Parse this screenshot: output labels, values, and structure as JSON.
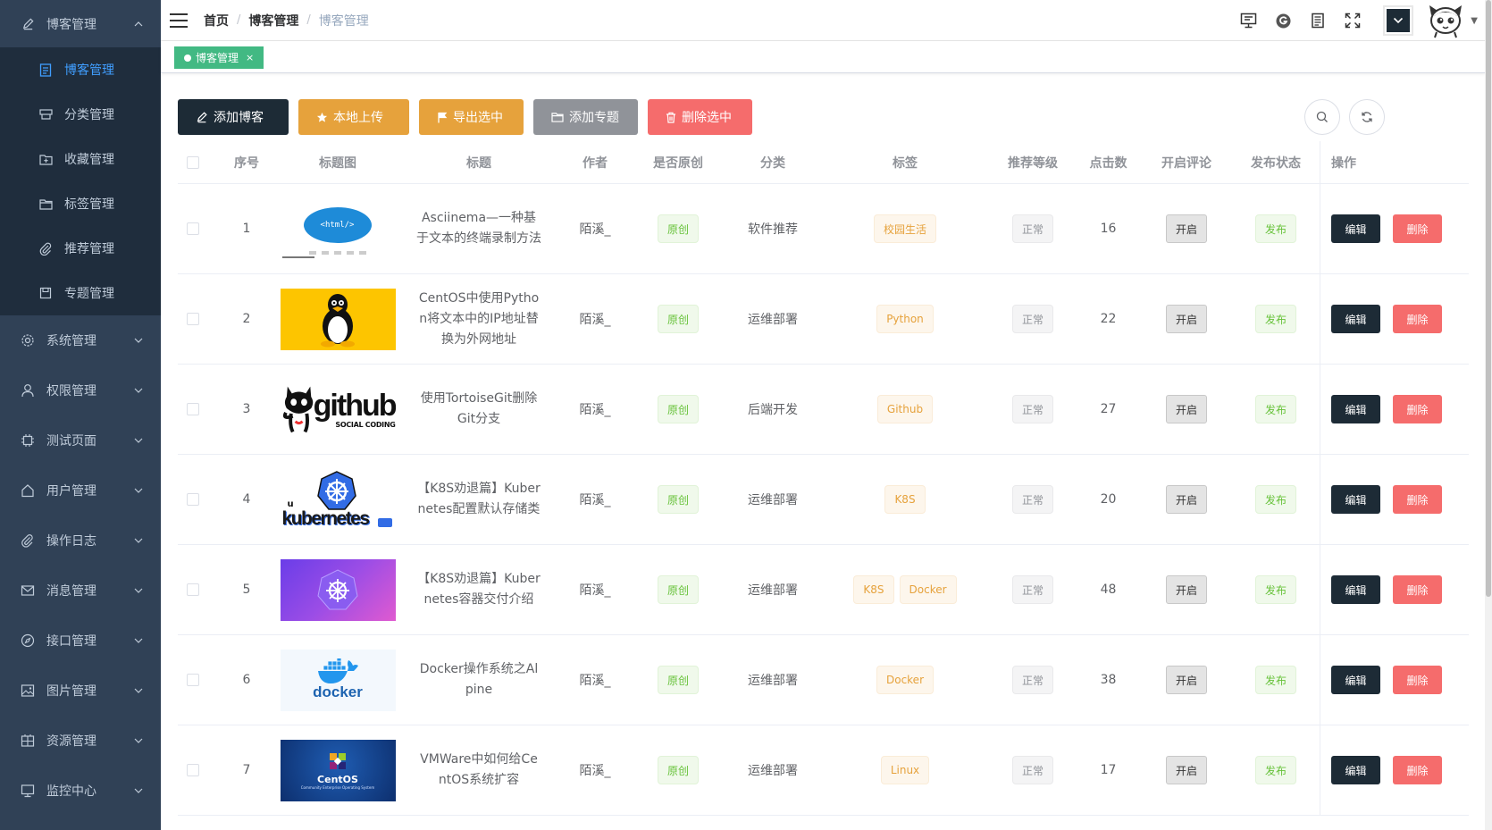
{
  "sidebar": {
    "open_menu": {
      "label": "博客管理",
      "icon": "edit-icon"
    },
    "sub_items": [
      {
        "label": "博客管理",
        "icon": "document-icon",
        "active": true
      },
      {
        "label": "分类管理",
        "icon": "category-icon"
      },
      {
        "label": "收藏管理",
        "icon": "folder-add-icon"
      },
      {
        "label": "标签管理",
        "icon": "folder-icon"
      },
      {
        "label": "推荐管理",
        "icon": "paperclip-icon"
      },
      {
        "label": "专题管理",
        "icon": "save-icon"
      }
    ],
    "groups": [
      {
        "label": "系统管理",
        "icon": "gear-icon"
      },
      {
        "label": "权限管理",
        "icon": "user-icon"
      },
      {
        "label": "测试页面",
        "icon": "chip-icon"
      },
      {
        "label": "用户管理",
        "icon": "house-icon"
      },
      {
        "label": "操作日志",
        "icon": "paperclip-icon"
      },
      {
        "label": "消息管理",
        "icon": "message-icon"
      },
      {
        "label": "接口管理",
        "icon": "compass-icon"
      },
      {
        "label": "图片管理",
        "icon": "picture-icon"
      },
      {
        "label": "资源管理",
        "icon": "grid-icon"
      },
      {
        "label": "监控中心",
        "icon": "monitor-icon"
      }
    ]
  },
  "navbar": {
    "breadcrumb": [
      "首页",
      "博客管理",
      "博客管理"
    ],
    "icons": [
      "monitor-icon",
      "g-circle-icon",
      "document-icon",
      "fullscreen-icon"
    ]
  },
  "tagsview": {
    "active_tag": "博客管理",
    "close": "×"
  },
  "toolbar": {
    "add_blog": "添加博客",
    "local_upload": "本地上传",
    "export_selected": "导出选中",
    "add_subject": "添加专题",
    "delete_selected": "删除选中"
  },
  "table": {
    "headers": {
      "no": "序号",
      "image": "标题图",
      "title": "标题",
      "author": "作者",
      "original": "是否原创",
      "category": "分类",
      "tags": "标签",
      "level": "推荐等级",
      "clicks": "点击数",
      "comment": "开启评论",
      "status": "发布状态",
      "ops": "操作"
    },
    "rows": [
      {
        "no": "1",
        "thumb": "html",
        "title": "Asciinema—一种基于文本的终端录制方法",
        "author": "陌溪_",
        "original": "原创",
        "category": "软件推荐",
        "tags": [
          "校园生活"
        ],
        "level": "正常",
        "clicks": "16",
        "comment": "开启",
        "status": "发布",
        "edit": "编辑",
        "delete": "删除"
      },
      {
        "no": "2",
        "thumb": "linux",
        "title": "CentOS中使用Python将文本中的IP地址替换为外网地址",
        "author": "陌溪_",
        "original": "原创",
        "category": "运维部署",
        "tags": [
          "Python"
        ],
        "level": "正常",
        "clicks": "22",
        "comment": "开启",
        "status": "发布",
        "edit": "编辑",
        "delete": "删除"
      },
      {
        "no": "3",
        "thumb": "github",
        "title": "使用TortoiseGit删除Git分支",
        "author": "陌溪_",
        "original": "原创",
        "category": "后端开发",
        "tags": [
          "Github"
        ],
        "level": "正常",
        "clicks": "27",
        "comment": "开启",
        "status": "发布",
        "edit": "编辑",
        "delete": "删除"
      },
      {
        "no": "4",
        "thumb": "kubernetes",
        "title": "【K8S劝退篇】Kubernetes配置默认存储类",
        "author": "陌溪_",
        "original": "原创",
        "category": "运维部署",
        "tags": [
          "K8S"
        ],
        "level": "正常",
        "clicks": "20",
        "comment": "开启",
        "status": "发布",
        "edit": "编辑",
        "delete": "删除"
      },
      {
        "no": "5",
        "thumb": "k8s-purple",
        "title": "【K8S劝退篇】Kubernetes容器交付介绍",
        "author": "陌溪_",
        "original": "原创",
        "category": "运维部署",
        "tags": [
          "K8S",
          "Docker"
        ],
        "level": "正常",
        "clicks": "48",
        "comment": "开启",
        "status": "发布",
        "edit": "编辑",
        "delete": "删除"
      },
      {
        "no": "6",
        "thumb": "docker",
        "title": "Docker操作系统之Alpine",
        "author": "陌溪_",
        "original": "原创",
        "category": "运维部署",
        "tags": [
          "Docker"
        ],
        "level": "正常",
        "clicks": "38",
        "comment": "开启",
        "status": "发布",
        "edit": "编辑",
        "delete": "删除"
      },
      {
        "no": "7",
        "thumb": "centos",
        "title": "VMWare中如何给CentOS系统扩容",
        "author": "陌溪_",
        "original": "原创",
        "category": "运维部署",
        "tags": [
          "Linux"
        ],
        "level": "正常",
        "clicks": "17",
        "comment": "开启",
        "status": "发布",
        "edit": "编辑",
        "delete": "删除"
      }
    ]
  },
  "thumb_text": {
    "html": "<html/>",
    "github": "github",
    "github_sub": "SOCIAL CODING",
    "docker": "docker",
    "centos": "CentOS",
    "centos_sub": "Community Enterprise Operating System",
    "kubernetes": "kubernetes"
  },
  "colors": {
    "sidebar_bg": "#304156",
    "submenu_bg": "#1f2d3d",
    "active": "#409eff",
    "dark_button": "#1d2b36",
    "warning": "#e6a23c",
    "info": "#909399",
    "danger": "#f56c6c",
    "tag_green": "#42b983",
    "success": "#67c23a"
  }
}
